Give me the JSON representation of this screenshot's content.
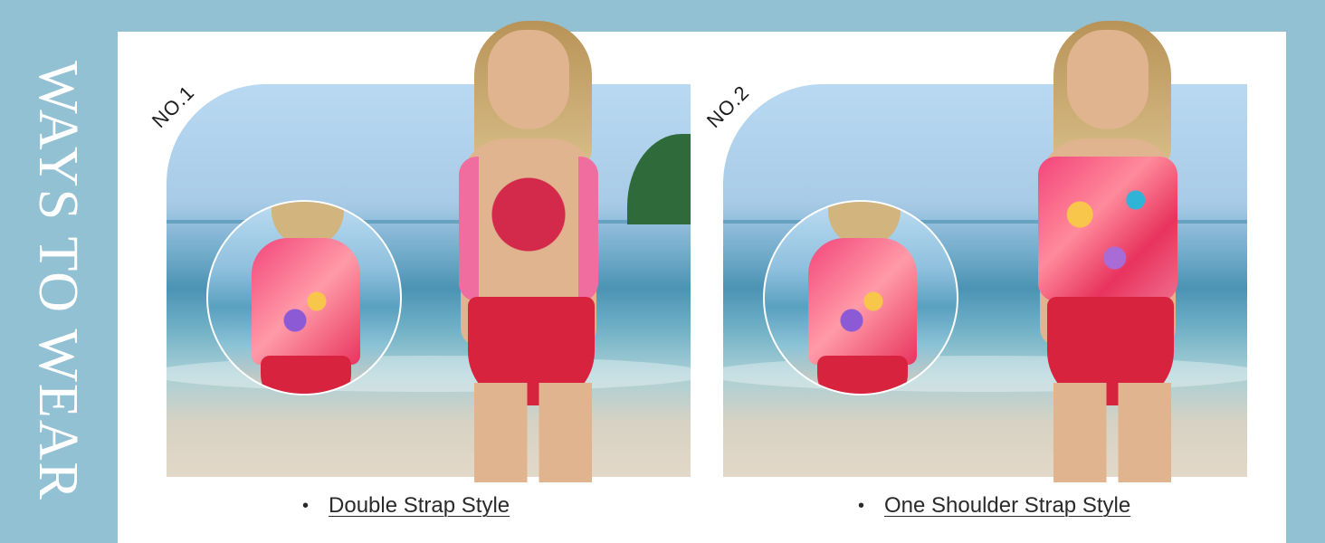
{
  "side_title": "WAYS TO WEAR",
  "styles": [
    {
      "number": "NO.1",
      "caption": "Double Strap Style",
      "bullet": "•"
    },
    {
      "number": "NO.2",
      "caption": "One Shoulder Strap Style",
      "bullet": "•"
    }
  ],
  "colors": {
    "background": "#93c1d4",
    "panel": "#ffffff",
    "swimsuit_red": "#d8233f",
    "text": "#2a2a2a"
  }
}
